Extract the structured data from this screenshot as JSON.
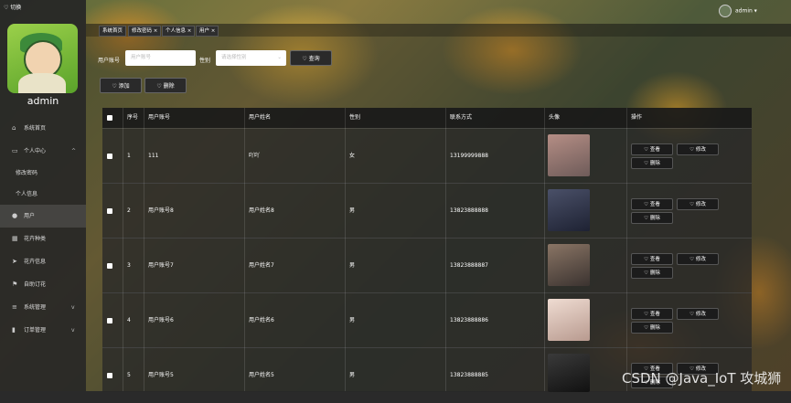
{
  "topbar": {
    "switch_label": "切换"
  },
  "user": {
    "name": "admin"
  },
  "menu": [
    {
      "label": "系统首页",
      "icon": "home-icon"
    },
    {
      "label": "个人中心",
      "icon": "person-card-icon",
      "arrow": "^"
    },
    {
      "label": "修改密码"
    },
    {
      "label": "个人信息"
    },
    {
      "label": "用户",
      "icon": "location-pin-icon"
    },
    {
      "label": "花卉种类",
      "icon": "grid-icon"
    },
    {
      "label": "花卉信息",
      "icon": "send-icon"
    },
    {
      "label": "自助订花",
      "icon": "flag-icon"
    },
    {
      "label": "系统管理",
      "icon": "list-icon",
      "arrow": "v"
    },
    {
      "label": "订单管理",
      "icon": "bar-chart-icon",
      "arrow": "v"
    }
  ],
  "header": {
    "admin_label": "admin ▾"
  },
  "tabs": [
    "系统首页",
    "修改密码 ×",
    "个人信息 ×",
    "用户 ×"
  ],
  "filter": {
    "account_label": "用户账号",
    "account_placeholder": "用户账号",
    "gender_label": "性别",
    "gender_placeholder": "请选择性别",
    "search_button": "♡ 查询",
    "add_button": "♡ 添加",
    "delete_button": "♡ 删除"
  },
  "table": {
    "headers": [
      "序号",
      "用户账号",
      "用户姓名",
      "性别",
      "联系方式",
      "头像",
      "操作"
    ],
    "rows": [
      {
        "index": "1",
        "account": "111",
        "name": "吖吖",
        "gender": "女",
        "phone": "13199999888",
        "avatar_color": "#c9a9a0"
      },
      {
        "index": "2",
        "account": "用户账号8",
        "name": "用户姓名8",
        "gender": "男",
        "phone": "13823888888",
        "avatar_color": "#3a3f55"
      },
      {
        "index": "3",
        "account": "用户账号7",
        "name": "用户姓名7",
        "gender": "男",
        "phone": "13823888887",
        "avatar_color": "#6b5a4e"
      },
      {
        "index": "4",
        "account": "用户账号6",
        "name": "用户姓名6",
        "gender": "男",
        "phone": "13823888886",
        "avatar_color": "#d9c2b8"
      },
      {
        "index": "5",
        "account": "用户账号5",
        "name": "用户姓名5",
        "gender": "男",
        "phone": "13823888885",
        "avatar_color": "#2a2a2a"
      }
    ],
    "actions": {
      "view": "♡ 查看",
      "edit": "♡ 修改",
      "delete": "♡ 删除"
    }
  },
  "watermark": "CSDN @Java_IoT 攻城狮"
}
